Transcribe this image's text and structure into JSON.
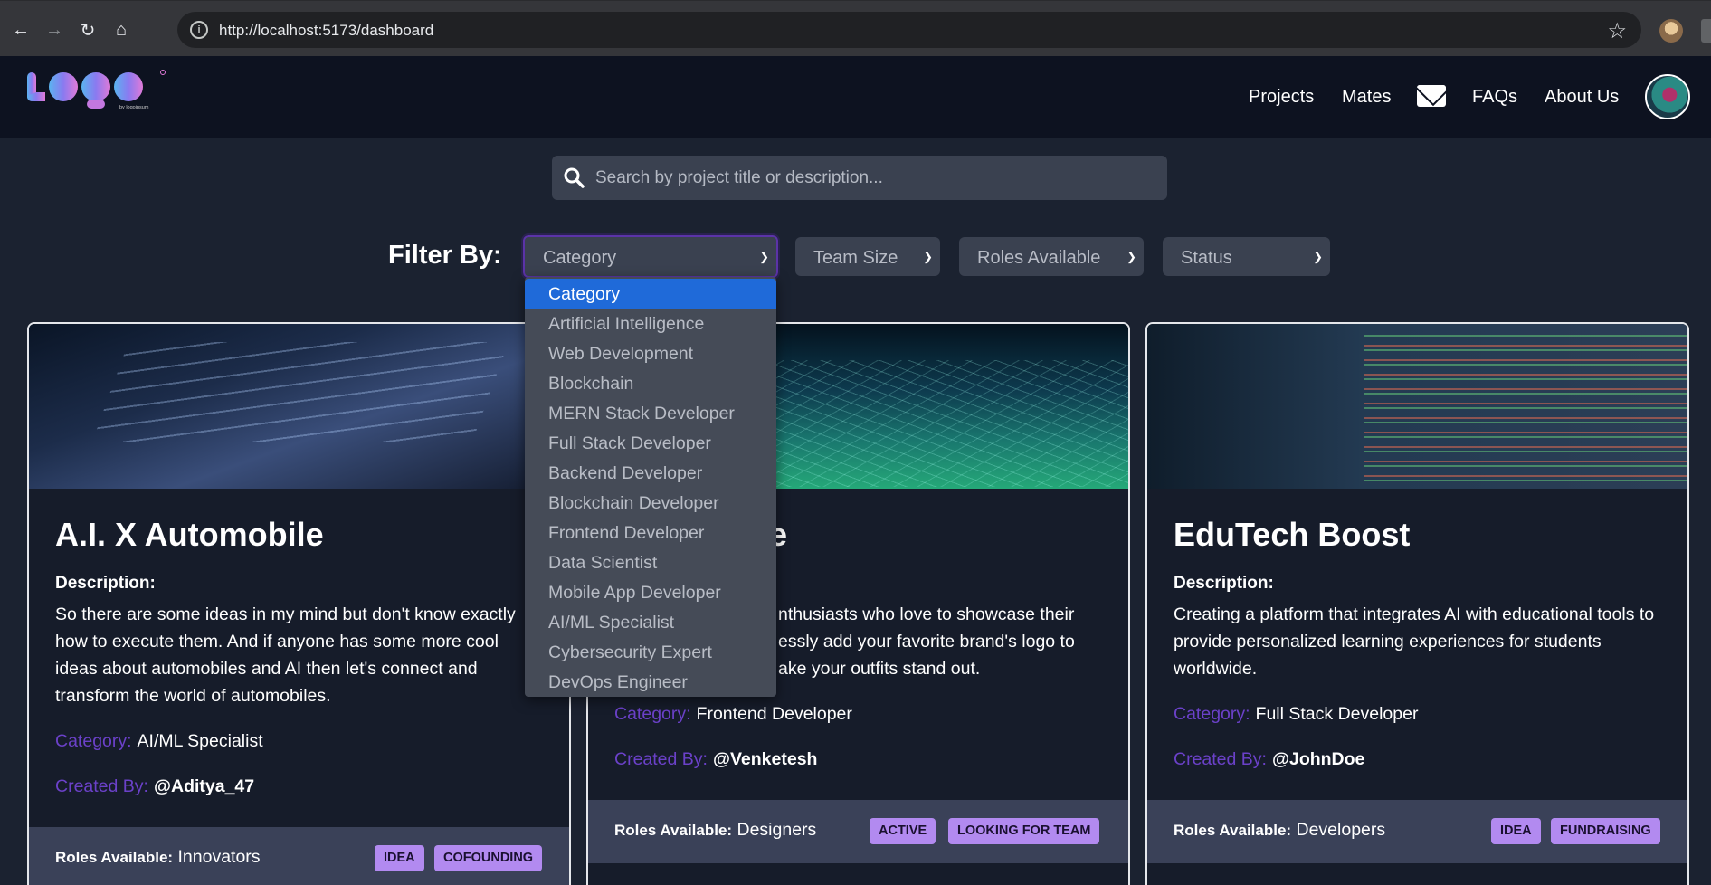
{
  "browser": {
    "url": "http://localhost:5173/dashboard"
  },
  "header": {
    "logo_text": "Logo",
    "logo_sub": "by logoipsum",
    "nav": [
      "Projects",
      "Mates",
      "FAQs",
      "About Us"
    ]
  },
  "search": {
    "placeholder": "Search by project title or description..."
  },
  "filters": {
    "label": "Filter By:",
    "selects": [
      {
        "value": "Category"
      },
      {
        "value": "Team Size"
      },
      {
        "value": "Roles Available"
      },
      {
        "value": "Status"
      }
    ],
    "category_options": [
      "Category",
      "Artificial Intelligence",
      "Web Development",
      "Blockchain",
      "MERN Stack Developer",
      "Full Stack Developer",
      "Backend Developer",
      "Blockchain Developer",
      "Frontend Developer",
      "Data Scientist",
      "Mobile App Developer",
      "AI/ML Specialist",
      "Cybersecurity Expert",
      "DevOps Engineer"
    ]
  },
  "labels": {
    "description": "Description:",
    "category": "Category:",
    "created_by": "Created By:",
    "roles_available": "Roles Available:"
  },
  "cards": [
    {
      "title": "A.I. X Automobile",
      "description": "So there are some ideas in my mind but don't know exactly how to execute them. And if anyone has some more cool ideas about automobiles and AI then let's connect and transform the world of automobiles.",
      "category": "AI/ML Specialist",
      "created_by": "@Aditya_47",
      "roles": "Innovators",
      "badges": [
        "IDEA",
        "COFOUNDING"
      ]
    },
    {
      "title": "e",
      "description": "nthusiasts who love to showcase their essly add your favorite brand's logo to ake your outfits stand out.",
      "category": "Frontend Developer",
      "created_by": "@Venketesh",
      "roles": "Designers",
      "badges": [
        "ACTIVE",
        "LOOKING FOR TEAM"
      ]
    },
    {
      "title": "EduTech Boost",
      "description": "Creating a platform that integrates AI with educational tools to provide personalized learning experiences for students worldwide.",
      "category": "Full Stack Developer",
      "created_by": "@JohnDoe",
      "roles": "Developers",
      "badges": [
        "IDEA",
        "FUNDRAISING"
      ]
    }
  ],
  "colors": {
    "accent": "#6b41c9",
    "badge": "#b28af0",
    "dropdown_selected": "#1f6ad9",
    "background": "#1b2230",
    "header": "#0d1220"
  },
  "icons": [
    "back-icon",
    "forward-icon",
    "reload-icon",
    "home-icon",
    "site-info-icon",
    "bookmark-star-icon",
    "mail-icon",
    "search-icon",
    "chevron-down-icon"
  ]
}
